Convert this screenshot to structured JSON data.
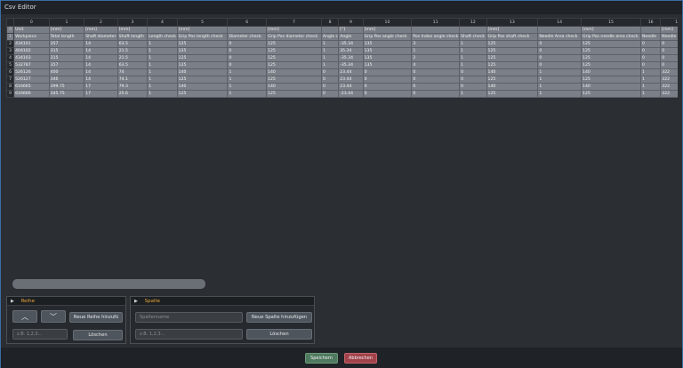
{
  "window": {
    "title": "Csv Editor"
  },
  "grid": {
    "column_headers": [
      "",
      "0",
      "1",
      "2",
      "3",
      "4",
      "5",
      "6",
      "7",
      "8",
      "9",
      "10",
      "11",
      "12",
      "13",
      "14",
      "15",
      "16",
      "17"
    ],
    "row_headers": [
      "0",
      "1",
      "2",
      "3",
      "4",
      "5",
      "6",
      "7",
      "8",
      "9"
    ],
    "rows": [
      [
        "Unit",
        "[mm]",
        "[mm]",
        "[mm]",
        "",
        "[mm]",
        "",
        "[mm]",
        "",
        "[°]",
        "[mm]",
        "",
        "",
        "[mm]",
        "",
        "[mm]",
        "",
        "[mm]"
      ],
      [
        "Workpiece",
        "Total length",
        "Shaft diameter",
        "Shaft length",
        "Length check",
        "Grip Pos length check",
        "Diameter check",
        "Grip Pos diameter check",
        "Angle check",
        "Angle",
        "Grip Pos angle check",
        "Pos Index angle check",
        "Shaft check",
        "Grip Pos shaft check",
        "Needle Area check",
        "Grip Pos needle area check",
        "Needle",
        "Needle Pos"
      ],
      [
        "434101",
        "357",
        "14",
        "63.5",
        "1",
        "125",
        "0",
        "125",
        "1",
        "-35.34",
        "135",
        "3",
        "1",
        "125",
        "0",
        "125",
        "0",
        "0"
      ],
      [
        "404102",
        "315",
        "14",
        "21.5",
        "1",
        "125",
        "0",
        "125",
        "1",
        "35.34",
        "135",
        "1",
        "1",
        "125",
        "0",
        "125",
        "0",
        "0"
      ],
      [
        "434103",
        "315",
        "14",
        "21.5",
        "1",
        "125",
        "0",
        "125",
        "1",
        "-35.34",
        "135",
        "2",
        "1",
        "125",
        "0",
        "125",
        "0",
        "0"
      ],
      [
        "532787",
        "357",
        "14",
        "63.5",
        "1",
        "125",
        "0",
        "125",
        "1",
        "-35.34",
        "135",
        "4",
        "1",
        "125",
        "0",
        "125",
        "0",
        "0"
      ],
      [
        "526126",
        "400",
        "14",
        "74",
        "1",
        "140",
        "1",
        "140",
        "0",
        "23.44",
        "0",
        "0",
        "0",
        "140",
        "1",
        "140",
        "1",
        "322"
      ],
      [
        "526127",
        "346",
        "14",
        "74.1",
        "1",
        "125",
        "1",
        "125",
        "0",
        "23.44",
        "0",
        "0",
        "0",
        "125",
        "1",
        "125",
        "1",
        "322"
      ],
      [
        "616665",
        "399.75",
        "17",
        "79.3",
        "1",
        "140",
        "1",
        "140",
        "0",
        "23.44",
        "0",
        "0",
        "0",
        "140",
        "1",
        "140",
        "1",
        "322"
      ],
      [
        "616666",
        "345.75",
        "17",
        "25.6",
        "1",
        "125",
        "1",
        "125",
        "0",
        "-23.44",
        "0",
        "0",
        "1",
        "125",
        "1",
        "125",
        "1",
        "322"
      ]
    ]
  },
  "row_panel": {
    "title": "Reihe",
    "add_button": "Neue Reihe hinzufü",
    "index_placeholder": "z.B. 1,2,3...",
    "delete_button": "Löschen",
    "up_icon": "chevron-up-icon",
    "down_icon": "chevron-down-icon"
  },
  "column_panel": {
    "title": "Spalte",
    "name_placeholder": "Spaltenname",
    "add_button": "Neue Spalte hinzufügen",
    "index_placeholder": "z.B. 1,2,3...",
    "delete_button": "Löschen"
  },
  "footer": {
    "save_button": "Speichern",
    "cancel_button": "Abbrechen"
  },
  "colors": {
    "accent_orange": "#e8a63b",
    "save_green": "#4f7a5f",
    "cancel_red": "#a2434b"
  }
}
